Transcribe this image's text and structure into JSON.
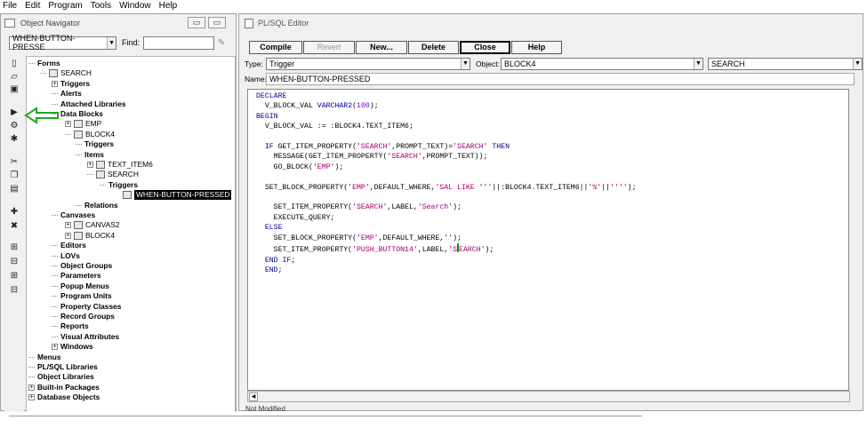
{
  "menubar": {
    "items": [
      "File",
      "Edit",
      "Program",
      "Tools",
      "Window",
      "Help"
    ]
  },
  "navigator": {
    "title": "Object Navigator",
    "selector_value": "WHEN-BUTTON-PRESSE",
    "find_label": "Find:",
    "find_value": "",
    "toolbar_icons": [
      "new-icon",
      "open-icon",
      "save-icon",
      "run-icon",
      "compile-icon",
      "debug-icon",
      "cut-icon",
      "copy-icon",
      "paste-icon",
      "create-icon",
      "delete-icon",
      "expand-icon",
      "collapse-icon",
      "expand-all-icon",
      "collapse-all-icon"
    ],
    "tree": [
      {
        "label": "Forms",
        "toggle": "-",
        "bold": true
      },
      {
        "label": "SEARCH",
        "toggle": "-",
        "icon": "form-icon"
      },
      {
        "label": "Triggers",
        "toggle": "+",
        "bold": true
      },
      {
        "label": "Alerts",
        "toggle": "-",
        "bold": true
      },
      {
        "label": "Attached Libraries",
        "toggle": "-",
        "bold": true
      },
      {
        "label": "Data Blocks",
        "toggle": "-",
        "bold": true
      },
      {
        "label": "EMP",
        "toggle": "+",
        "icon": "block-icon"
      },
      {
        "label": "BLOCK4",
        "toggle": "-",
        "icon": "block-icon"
      },
      {
        "label": "Triggers",
        "toggle": "-",
        "bold": true
      },
      {
        "label": "Items",
        "toggle": "-",
        "bold": true
      },
      {
        "label": "TEXT_ITEM6",
        "toggle": "+",
        "icon": "text-item-icon"
      },
      {
        "label": "SEARCH",
        "toggle": "-",
        "icon": "button-icon"
      },
      {
        "label": "Triggers",
        "toggle": "-",
        "bold": true
      },
      {
        "label": "WHEN-BUTTON-PRESSED",
        "toggle": "",
        "icon": "trigger-icon",
        "selected": true
      },
      {
        "label": "Relations",
        "toggle": "-",
        "bold": true
      },
      {
        "label": "Canvases",
        "toggle": "-",
        "bold": true
      },
      {
        "label": "CANVAS2",
        "toggle": "+",
        "icon": "canvas-icon"
      },
      {
        "label": "BLOCK4",
        "toggle": "+",
        "icon": "canvas-icon"
      },
      {
        "label": "Editors",
        "toggle": "-",
        "bold": true
      },
      {
        "label": "LOVs",
        "toggle": "-",
        "bold": true
      },
      {
        "label": "Object Groups",
        "toggle": "-",
        "bold": true
      },
      {
        "label": "Parameters",
        "toggle": "-",
        "bold": true
      },
      {
        "label": "Popup Menus",
        "toggle": "-",
        "bold": true
      },
      {
        "label": "Program Units",
        "toggle": "-",
        "bold": true
      },
      {
        "label": "Property Classes",
        "toggle": "-",
        "bold": true
      },
      {
        "label": "Record Groups",
        "toggle": "-",
        "bold": true
      },
      {
        "label": "Reports",
        "toggle": "-",
        "bold": true
      },
      {
        "label": "Visual Attributes",
        "toggle": "-",
        "bold": true
      },
      {
        "label": "Windows",
        "toggle": "+",
        "bold": true
      },
      {
        "label": "Menus",
        "toggle": "-",
        "bold": true
      },
      {
        "label": "PL/SQL Libraries",
        "toggle": "-",
        "bold": true
      },
      {
        "label": "Object Libraries",
        "toggle": "-",
        "bold": true
      },
      {
        "label": "Built-in Packages",
        "toggle": "+",
        "bold": true
      },
      {
        "label": "Database Objects",
        "toggle": "+",
        "bold": true
      }
    ]
  },
  "editor": {
    "title": "PL/SQL Editor",
    "buttons": [
      {
        "label": "Compile",
        "disabled": false,
        "default": false
      },
      {
        "label": "Revert",
        "disabled": true,
        "default": false
      },
      {
        "label": "New...",
        "disabled": false,
        "default": false
      },
      {
        "label": "Delete",
        "disabled": false,
        "default": false
      },
      {
        "label": "Close",
        "disabled": false,
        "default": true
      },
      {
        "label": "Help",
        "disabled": false,
        "default": false
      }
    ],
    "type_label": "Type:",
    "type_value": "Trigger",
    "object_label": "Object:",
    "object_value": "BLOCK4",
    "object2_value": "SEARCH",
    "name_label": "Name:",
    "name_value": "WHEN-BUTTON-PRESSED",
    "status_text": "Not Modified",
    "code_lines": [
      "DECLARE",
      "  V_BLOCK_VAL VARCHAR2(100);",
      "BEGIN",
      "  V_BLOCK_VAL := :BLOCK4.TEXT_ITEM6;",
      "",
      "  IF GET_ITEM_PROPERTY('SEARCH',PROMPT_TEXT)='SEARCH' THEN",
      "    MESSAGE(GET_ITEM_PROPERTY('SEARCH',PROMPT_TEXT));",
      "    GO_BLOCK('EMP');",
      "",
      "  SET_BLOCK_PROPERTY('EMP',DEFAULT_WHERE,'SAL LIKE '''||:BLOCK4.TEXT_ITEM6||'%'||'''');",
      "",
      "    SET_ITEM_PROPERTY('SEARCH',LABEL,'Search');",
      "    EXECUTE_QUERY;",
      "  ELSE",
      "    SET_BLOCK_PROPERTY('EMP',DEFAULT_WHERE,'');",
      "    SET_ITEM_PROPERTY('PUSH_BUTTON14',LABEL,'SEARCH');",
      "  END IF;",
      "  END;"
    ]
  },
  "colors": {
    "keyword": "#00008b",
    "string": "#a0006e",
    "number": "#7a00c8",
    "arrow": "#22a822",
    "selection": "#000000"
  }
}
